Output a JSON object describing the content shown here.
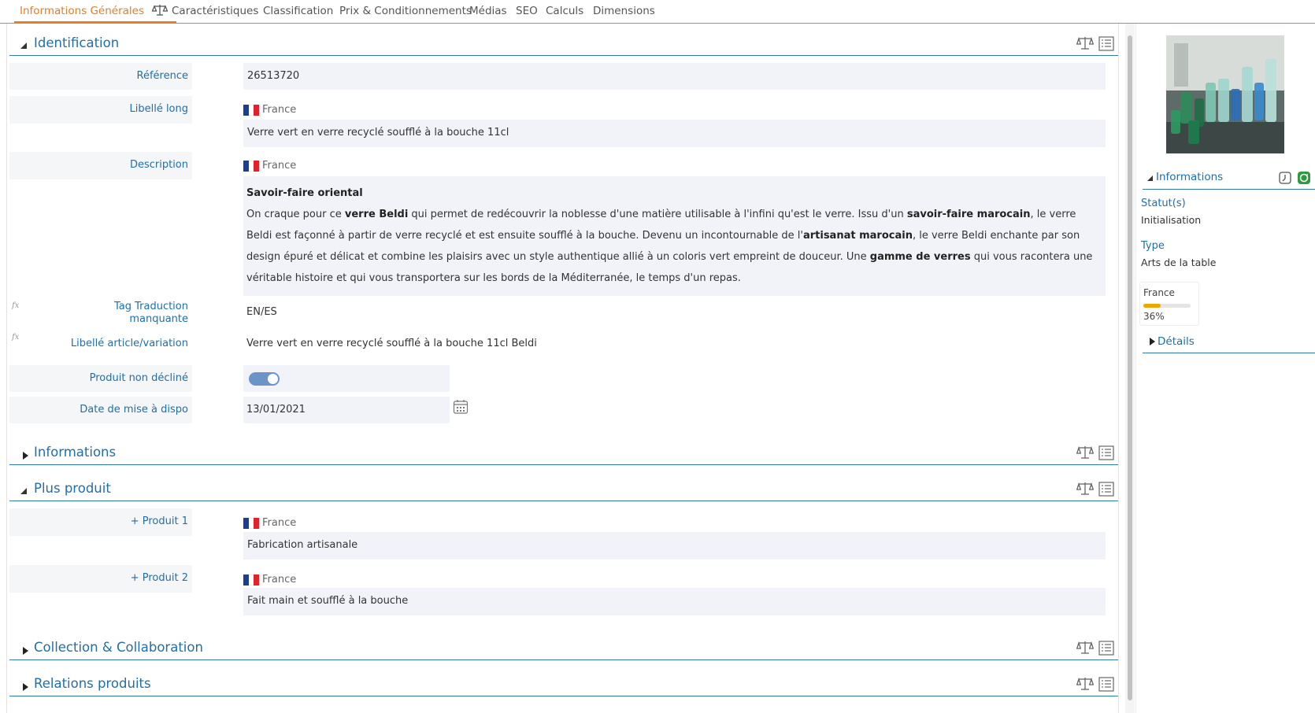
{
  "tabs": [
    {
      "label": "Informations Générales",
      "active": true
    },
    {
      "label": "Caractéristiques"
    },
    {
      "label": "Classification"
    },
    {
      "label": "Prix & Conditionnements"
    },
    {
      "label": "Médias"
    },
    {
      "label": "SEO"
    },
    {
      "label": "Calculs"
    },
    {
      "label": "Dimensions"
    }
  ],
  "sections": {
    "identification": "Identification",
    "informations": "Informations",
    "plus_produit": "Plus produit",
    "collection": "Collection & Collaboration",
    "relations": "Relations produits"
  },
  "fields": {
    "reference": {
      "label": "Référence",
      "value": "26513720"
    },
    "libelle_long": {
      "label": "Libellé long",
      "locale": "France",
      "value": "Verre vert en verre recyclé soufflé à la bouche 11cl"
    },
    "description": {
      "label": "Description",
      "locale": "France",
      "heading": "Savoir-faire oriental",
      "p1": "On craque pour ce ",
      "b1": "verre Beldi",
      "p2": " qui permet de redécouvrir la noblesse d'une matière utilisable à l'infini qu'est le verre. Issu d'un ",
      "b2": "savoir-faire marocain",
      "p3": ", le verre Beldi est façonné à partir de verre recyclé et est ensuite soufflé à la bouche. Devenu un incontournable de l'",
      "b3": "artisanat marocain",
      "p4": ", le verre Beldi enchante par son design épuré et délicat et combine les plaisirs avec un style authentique allié à un coloris vert empreint de douceur. Une ",
      "b4": "gamme de verres",
      "p5": " qui vous racontera une véritable histoire et qui vous transportera sur les bords de la Méditerranée, le temps d'un repas."
    },
    "tag_traduction": {
      "label_line1": "Tag Traduction",
      "label_line2": "manquante",
      "value": "EN/ES",
      "fx": "fx"
    },
    "libelle_article": {
      "label": "Libellé article/variation",
      "value": "Verre vert en verre recyclé soufflé à la bouche 11cl Beldi",
      "fx": "fx"
    },
    "produit_non_decline": {
      "label": "Produit non décliné",
      "checked": true
    },
    "date_mise_dispo": {
      "label": "Date de mise à dispo",
      "value": "13/01/2021"
    },
    "produit1": {
      "label": "+ Produit 1",
      "locale": "France",
      "value": "Fabrication artisanale"
    },
    "produit2": {
      "label": "+ Produit 2",
      "locale": "France",
      "value": "Fait main et soufflé à la bouche"
    }
  },
  "right_panel": {
    "info_title": "Informations",
    "statut_label": "Statut(s)",
    "statut_value": "Initialisation",
    "type_label": "Type",
    "type_value": "Arts de la table",
    "completion": {
      "locale": "France",
      "percent_text": "36%",
      "percent": 36,
      "color": "#f0a500"
    },
    "details_title": "Détails"
  },
  "colors": {
    "accent": "#e67e22",
    "link": "#1f6fa8",
    "section_line": "#2d7ab0"
  }
}
